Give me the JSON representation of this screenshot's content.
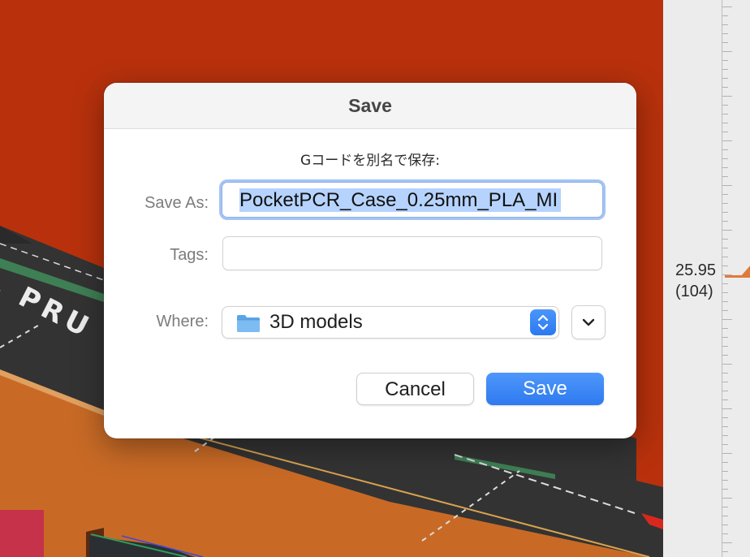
{
  "background": {
    "bed_label": "L PRU",
    "layer_height": "25.95",
    "layer_number": "(104)"
  },
  "dialog": {
    "title": "Save",
    "message": "Gコードを別名で保存:",
    "save_as": {
      "label": "Save As:",
      "value": "PocketPCR_Case_0.25mm_PLA_MI"
    },
    "tags": {
      "label": "Tags:",
      "value": ""
    },
    "where": {
      "label": "Where:",
      "value": "3D models"
    },
    "buttons": {
      "cancel": "Cancel",
      "save": "Save"
    }
  },
  "icons": {
    "folder": "folder-icon",
    "stepper": "up-down-chevron-icon",
    "expand": "chevron-down-icon"
  },
  "colors": {
    "accent": "#2e7af0",
    "background_red": "#b8310c",
    "focus_ring": "#a4c4f3",
    "selection": "#b6d3fd"
  }
}
